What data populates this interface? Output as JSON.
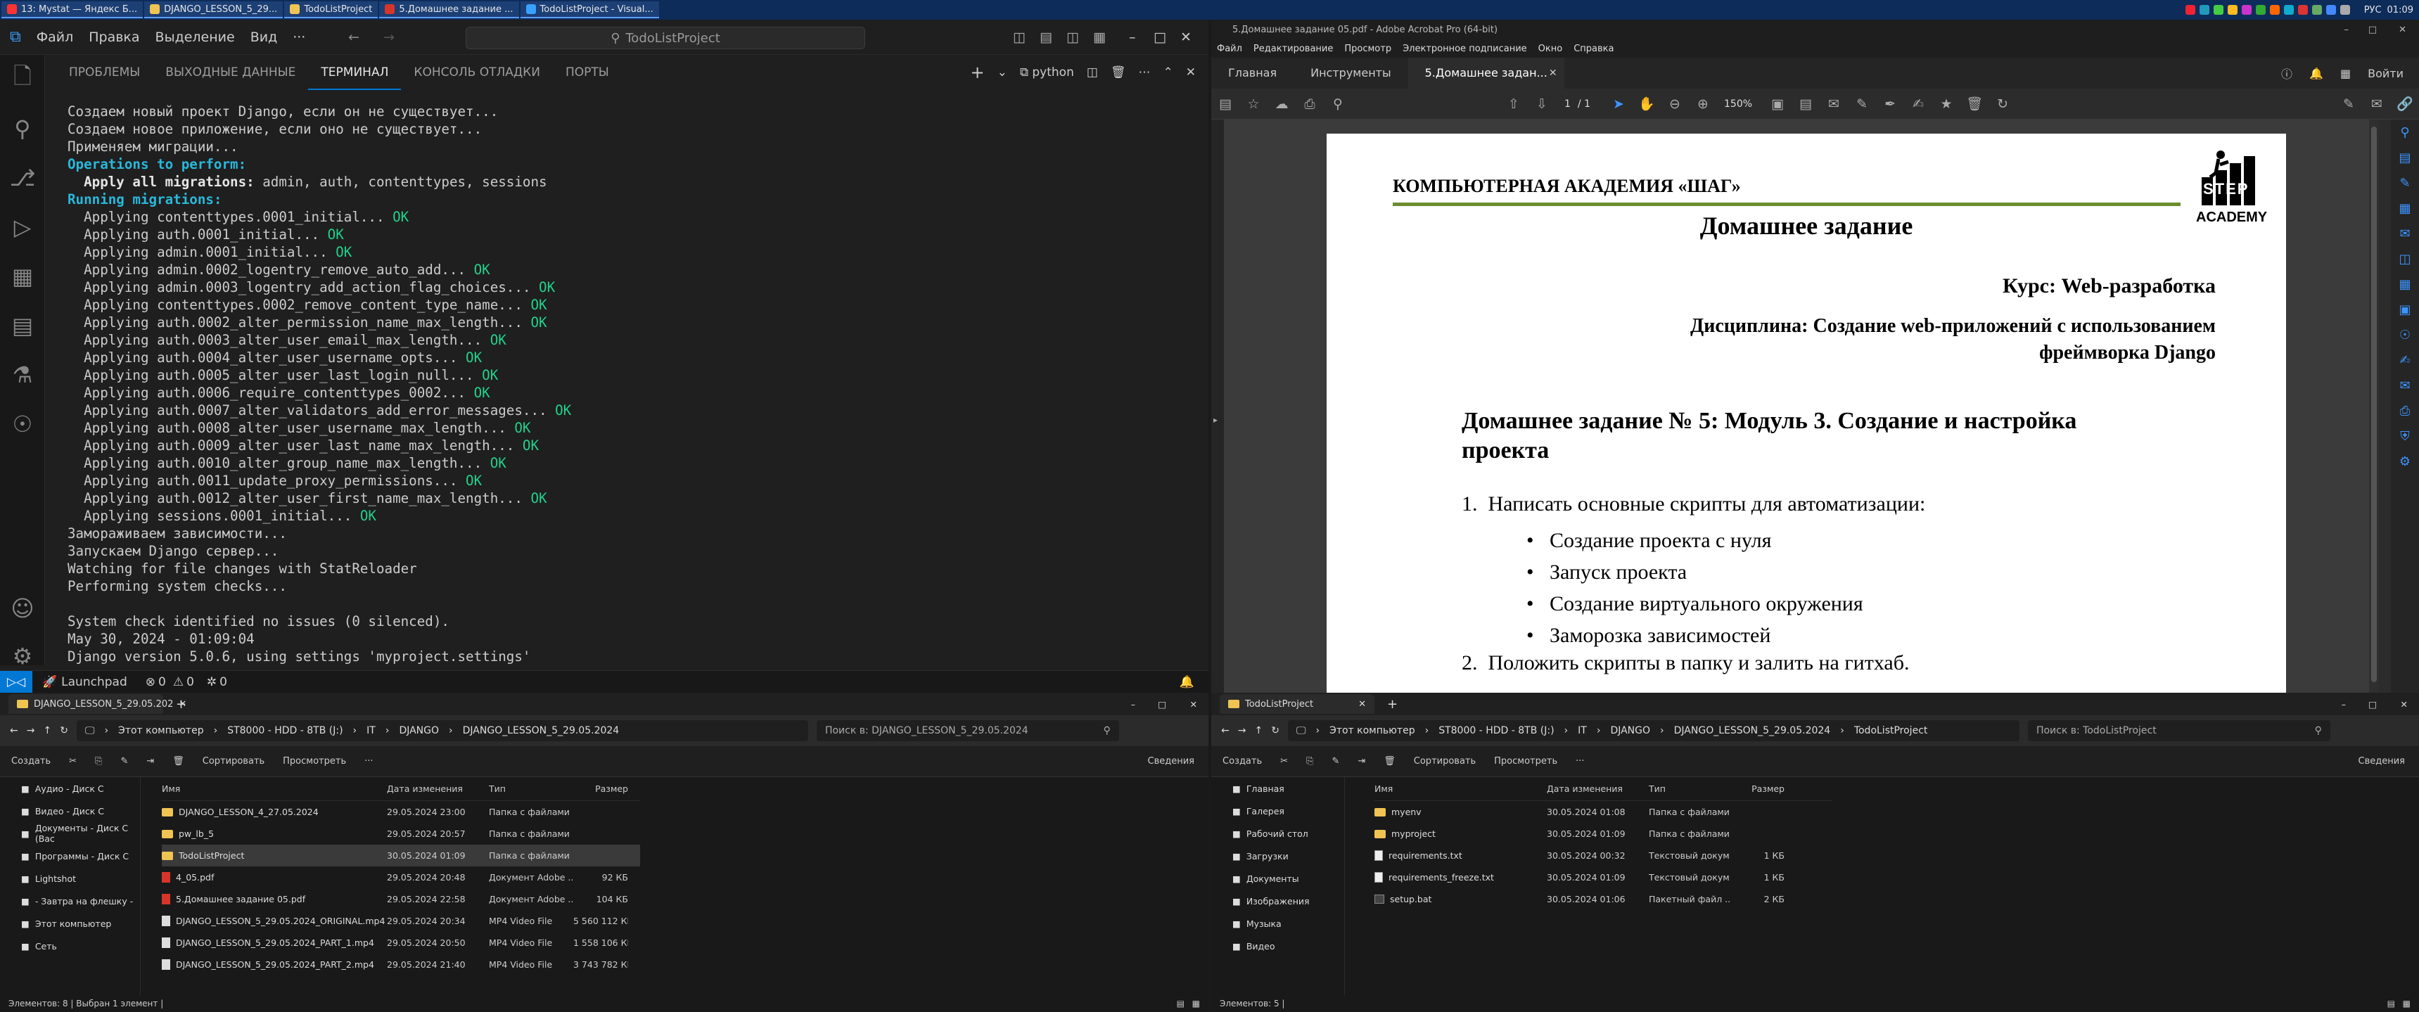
{
  "taskbar": {
    "tasks": [
      {
        "label": "13: Mystat — Яндекс Б...",
        "color": "#ff3333"
      },
      {
        "label": "DJANGO_LESSON_5_29...",
        "color": "#f0c453"
      },
      {
        "label": "TodoListProject",
        "color": "#f0c453"
      },
      {
        "label": "5.Домашнее задание ...",
        "color": "#d8352a"
      },
      {
        "label": "TodoListProject - Visual...",
        "color": "#3aa0ff"
      }
    ],
    "lang": "РУС",
    "time": "01:09"
  },
  "vscode": {
    "menu": [
      "Файл",
      "Правка",
      "Выделение",
      "Вид",
      "···"
    ],
    "search": "TodoListProject",
    "panel_tabs": [
      "ПРОБЛЕМЫ",
      "ВЫХОДНЫЕ ДАННЫЕ",
      "ТЕРМИНАЛ",
      "КОНСОЛЬ ОТЛАДКИ",
      "ПОРТЫ"
    ],
    "active_tab": 2,
    "terminal_kind": "python",
    "terminal_lines": [
      {
        "t": "Создаем новый проект Django, если он не существует...",
        "s": ""
      },
      {
        "t": "Создаем новое приложение, если оно не существует...",
        "s": ""
      },
      {
        "t": "Применяем миграции...",
        "s": ""
      },
      {
        "t": "Operations to perform:",
        "s": "cy"
      },
      {
        "t": "  Apply all migrations:",
        "s": "bold",
        "rest": " admin, auth, contenttypes, sessions"
      },
      {
        "t": "Running migrations:",
        "s": "cy"
      },
      {
        "t": "  Applying contenttypes.0001_initial...",
        "ok": " OK"
      },
      {
        "t": "  Applying auth.0001_initial...",
        "ok": " OK"
      },
      {
        "t": "  Applying admin.0001_initial...",
        "ok": " OK"
      },
      {
        "t": "  Applying admin.0002_logentry_remove_auto_add...",
        "ok": " OK"
      },
      {
        "t": "  Applying admin.0003_logentry_add_action_flag_choices...",
        "ok": " OK"
      },
      {
        "t": "  Applying contenttypes.0002_remove_content_type_name...",
        "ok": " OK"
      },
      {
        "t": "  Applying auth.0002_alter_permission_name_max_length...",
        "ok": " OK"
      },
      {
        "t": "  Applying auth.0003_alter_user_email_max_length...",
        "ok": " OK"
      },
      {
        "t": "  Applying auth.0004_alter_user_username_opts...",
        "ok": " OK"
      },
      {
        "t": "  Applying auth.0005_alter_user_last_login_null...",
        "ok": " OK"
      },
      {
        "t": "  Applying auth.0006_require_contenttypes_0002...",
        "ok": " OK"
      },
      {
        "t": "  Applying auth.0007_alter_validators_add_error_messages...",
        "ok": " OK"
      },
      {
        "t": "  Applying auth.0008_alter_user_username_max_length...",
        "ok": " OK"
      },
      {
        "t": "  Applying auth.0009_alter_user_last_name_max_length...",
        "ok": " OK"
      },
      {
        "t": "  Applying auth.0010_alter_group_name_max_length...",
        "ok": " OK"
      },
      {
        "t": "  Applying auth.0011_update_proxy_permissions...",
        "ok": " OK"
      },
      {
        "t": "  Applying auth.0012_alter_user_first_name_max_length...",
        "ok": " OK"
      },
      {
        "t": "  Applying sessions.0001_initial...",
        "ok": " OK"
      },
      {
        "t": "Замораживаем зависимости...",
        "s": ""
      },
      {
        "t": "Запускаем Django сервер...",
        "s": ""
      },
      {
        "t": "Watching for file changes with StatReloader",
        "s": ""
      },
      {
        "t": "Performing system checks...",
        "s": ""
      },
      {
        "t": "",
        "s": ""
      },
      {
        "t": "System check identified no issues (0 silenced).",
        "s": ""
      },
      {
        "t": "May 30, 2024 - 01:09:04",
        "s": ""
      },
      {
        "t": "Django version 5.0.6, using settings 'myproject.settings'",
        "s": ""
      }
    ],
    "status": {
      "launchpad": "Launchpad",
      "errors": "0",
      "warnings": "0",
      "ports": "0"
    }
  },
  "acrobat": {
    "title": "5.Домашнее задание 05.pdf - Adobe Acrobat Pro (64-bit)",
    "menu": [
      "Файл",
      "Редактирование",
      "Просмотр",
      "Электронное подписание",
      "Окно",
      "Справка"
    ],
    "tabs": [
      "Главная",
      "Инструменты",
      "5.Домашнее задан..."
    ],
    "login": "Войти",
    "page_num": "1",
    "page_total": "/ 1",
    "zoom": "150%",
    "doc": {
      "org": "КОМПЬЮТЕРНАЯ АКАДЕМИЯ «ШАГ»",
      "title": "Домашнее задание",
      "course": "Курс: Web-разработка",
      "discipline1": "Дисциплина: Создание web-приложений с использованием",
      "discipline2": "фреймворка Django",
      "heading1": "Домашнее задание № 5: Модуль 3. Создание и настройка",
      "heading2": "проекта",
      "item1": "Написать основные скрипты для автоматизации:",
      "bullets": [
        "Создание проекта с нуля",
        "Запуск проекта",
        "Создание виртуального окружения",
        "Заморозка зависимостей"
      ],
      "item2": "Положить скрипты в папку и залить на гитхаб.",
      "logo_step": "STEP",
      "logo_academy": "ACADEMY"
    }
  },
  "explorer1": {
    "tab": "DJANGO_LESSON_5_29.05.202",
    "path": [
      "Этот компьютер",
      "ST8000 - HDD - 8TB (J:)",
      "IT",
      "DJANGO",
      "DJANGO_LESSON_5_29.05.2024"
    ],
    "search": "Поиск в: DJANGO_LESSON_5_29.05.2024",
    "cmd": [
      "Создать",
      "Сортировать",
      "Просмотреть",
      "···",
      "Сведения"
    ],
    "nav": [
      "Аудио - Диск C",
      "Видео - Диск C",
      "Документы - Диск C (Bac",
      "Программы - Диск C",
      "Lightshot",
      "- Завтра на флешку -",
      "Этот компьютер",
      "Сеть"
    ],
    "headers": [
      "Имя",
      "Дата изменения",
      "Тип",
      "Размер"
    ],
    "rows": [
      {
        "name": "DJANGO_LESSON_4_27.05.2024",
        "date": "29.05.2024 23:00",
        "type": "Папка с файлами",
        "size": "",
        "icon": "fold"
      },
      {
        "name": "pw_lb_5",
        "date": "29.05.2024 20:57",
        "type": "Папка с файлами",
        "size": "",
        "icon": "fold"
      },
      {
        "name": "TodoListProject",
        "date": "30.05.2024 01:09",
        "type": "Папка с файлами",
        "size": "",
        "icon": "fold"
      },
      {
        "name": "4_05.pdf",
        "date": "29.05.2024 20:48",
        "type": "Документ Adobe ...",
        "size": "92 КБ",
        "icon": "pdf"
      },
      {
        "name": "5.Домашнее задание 05.pdf",
        "date": "29.05.2024 22:58",
        "type": "Документ Adobe ...",
        "size": "104 КБ",
        "icon": "pdf"
      },
      {
        "name": "DJANGO_LESSON_5_29.05.2024_ORIGINAL.mp4",
        "date": "29.05.2024 20:34",
        "type": "MP4 Video File",
        "size": "5 560 112 КБ",
        "icon": "mp4"
      },
      {
        "name": "DJANGO_LESSON_5_29.05.2024_PART_1.mp4",
        "date": "29.05.2024 20:50",
        "type": "MP4 Video File",
        "size": "1 558 106 КБ",
        "icon": "mp4"
      },
      {
        "name": "DJANGO_LESSON_5_29.05.2024_PART_2.mp4",
        "date": "29.05.2024 21:40",
        "type": "MP4 Video File",
        "size": "3 743 782 КБ",
        "icon": "mp4"
      }
    ],
    "selected": 2,
    "status": "Элементов: 8   |   Выбран 1 элемент   |"
  },
  "explorer2": {
    "tab": "TodoListProject",
    "path": [
      "Этот компьютер",
      "ST8000 - HDD - 8TB (J:)",
      "IT",
      "DJANGO",
      "DJANGO_LESSON_5_29.05.2024",
      "TodoListProject"
    ],
    "search": "Поиск в: TodoListProject",
    "cmd": [
      "Создать",
      "Сортировать",
      "Просмотреть",
      "···",
      "Сведения"
    ],
    "nav": [
      "Главная",
      "Галерея",
      "Рабочий стол",
      "Загрузки",
      "Документы",
      "Изображения",
      "Музыка",
      "Видео"
    ],
    "headers": [
      "Имя",
      "Дата изменения",
      "Тип",
      "Размер"
    ],
    "rows": [
      {
        "name": "myenv",
        "date": "30.05.2024 01:08",
        "type": "Папка с файлами",
        "size": "",
        "icon": "fold"
      },
      {
        "name": "myproject",
        "date": "30.05.2024 01:09",
        "type": "Папка с файлами",
        "size": "",
        "icon": "fold"
      },
      {
        "name": "requirements.txt",
        "date": "30.05.2024 00:32",
        "type": "Текстовый докум...",
        "size": "1 КБ",
        "icon": "txt"
      },
      {
        "name": "requirements_freeze.txt",
        "date": "30.05.2024 01:09",
        "type": "Текстовый докум...",
        "size": "1 КБ",
        "icon": "txt"
      },
      {
        "name": "setup.bat",
        "date": "30.05.2024 01:06",
        "type": "Пакетный файл ...",
        "size": "2 КБ",
        "icon": "bat"
      }
    ],
    "status": "Элементов: 5   |"
  }
}
